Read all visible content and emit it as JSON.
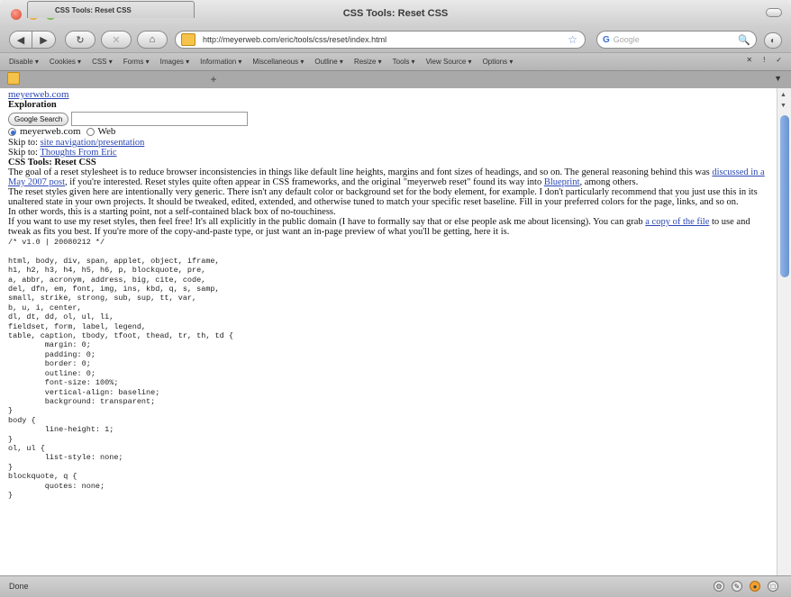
{
  "window": {
    "title": "CSS Tools: Reset CSS"
  },
  "nav": {
    "back": "◀",
    "forward": "▶",
    "reload": "↻",
    "stop": "✕",
    "home": "⌂",
    "url": "http://meyerweb.com/eric/tools/css/reset/index.html",
    "bookmark_star": "☆",
    "search_engine": "G",
    "search_placeholder": "Google",
    "search_icon": "🔍",
    "addon": "◐"
  },
  "devtoolbar": {
    "items": [
      "Disable ▾",
      "Cookies ▾",
      "CSS ▾",
      "Forms ▾",
      "Images ▾",
      "Information ▾",
      "Miscellaneous ▾",
      "Outline ▾",
      "Resize ▾",
      "Tools ▾",
      "View Source ▾",
      "Options ▾"
    ],
    "right": [
      "✕",
      "!",
      "✓"
    ]
  },
  "tabs": {
    "active_label": "CSS Tools: Reset CSS",
    "new_tab": "+",
    "tab_list": "▼"
  },
  "page": {
    "site_link": "meyerweb.com",
    "section_label": "Exploration",
    "search_button": "Google Search",
    "radio_site": "meyerweb.com",
    "radio_web": "Web",
    "skip1_prefix": "Skip to: ",
    "skip1_link": "site navigation/presentation",
    "skip2_prefix": "Skip to: ",
    "skip2_link": "Thoughts From Eric",
    "heading": "CSS Tools: Reset CSS",
    "p1_a": "The goal of a reset stylesheet is to reduce browser inconsistencies in things like default line heights, margins and font sizes of headings, and so on. The general reasoning behind this was ",
    "p1_link1": "discussed in a May 2007 post",
    "p1_b": ", if you're interested. Reset styles quite often appear in CSS frameworks, and the original \"meyerweb reset\" found its way into ",
    "p1_link2": "Blueprint",
    "p1_c": ", among others.",
    "p2": "The reset styles given here are intentionally very generic. There isn't any default color or background set for the body element, for example. I don't particularly recommend that you just use this in its unaltered state in your own projects. It should be tweaked, edited, extended, and otherwise tuned to match your specific reset baseline. Fill in your preferred colors for the page, links, and so on.",
    "p3": "In other words, this is a starting point, not a self-contained black box of no-touchiness.",
    "p4_a": "If you want to use my reset styles, then feel free! It's all explicitly in the public domain (I have to formally say that or else people ask me about licensing). You can grab ",
    "p4_link": "a copy of the file",
    "p4_b": " to use and tweak as fits you best. If you're more of the copy-and-paste type, or just want an in-page preview of what you'll be getting, here it is.",
    "code": "/* v1.0 | 20080212 */\n\nhtml, body, div, span, applet, object, iframe,\nh1, h2, h3, h4, h5, h6, p, blockquote, pre,\na, abbr, acronym, address, big, cite, code,\ndel, dfn, em, font, img, ins, kbd, q, s, samp,\nsmall, strike, strong, sub, sup, tt, var,\nb, u, i, center,\ndl, dt, dd, ol, ul, li,\nfieldset, form, label, legend,\ntable, caption, tbody, tfoot, thead, tr, th, td {\n        margin: 0;\n        padding: 0;\n        border: 0;\n        outline: 0;\n        font-size: 100%;\n        vertical-align: baseline;\n        background: transparent;\n}\nbody {\n        line-height: 1;\n}\nol, ul {\n        list-style: none;\n}\nblockquote, q {\n        quotes: none;\n}"
  },
  "status": {
    "text": "Done",
    "icons": [
      "⚙",
      "✎",
      "●",
      "□"
    ]
  }
}
